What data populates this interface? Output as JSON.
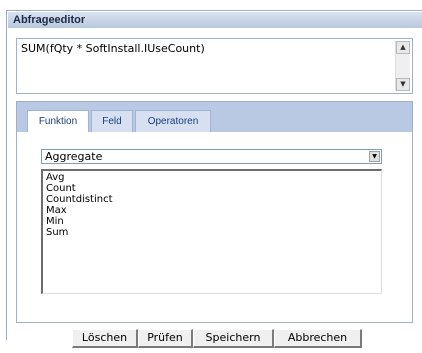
{
  "window": {
    "title": "Abfrageeditor"
  },
  "editor": {
    "expression": "SUM(fQty * SoftInstall.IUseCount)"
  },
  "tabs": [
    {
      "label": "Funktion",
      "active": true
    },
    {
      "label": "Feld",
      "active": false
    },
    {
      "label": "Operatoren",
      "active": false
    }
  ],
  "function_category": {
    "selected": "Aggregate"
  },
  "function_list": [
    "Avg",
    "Count",
    "Countdistinct",
    "Max",
    "Min",
    "Sum"
  ],
  "buttons": {
    "clear": "Löschen",
    "check": "Prüfen",
    "save": "Speichern",
    "cancel": "Abbrechen"
  }
}
